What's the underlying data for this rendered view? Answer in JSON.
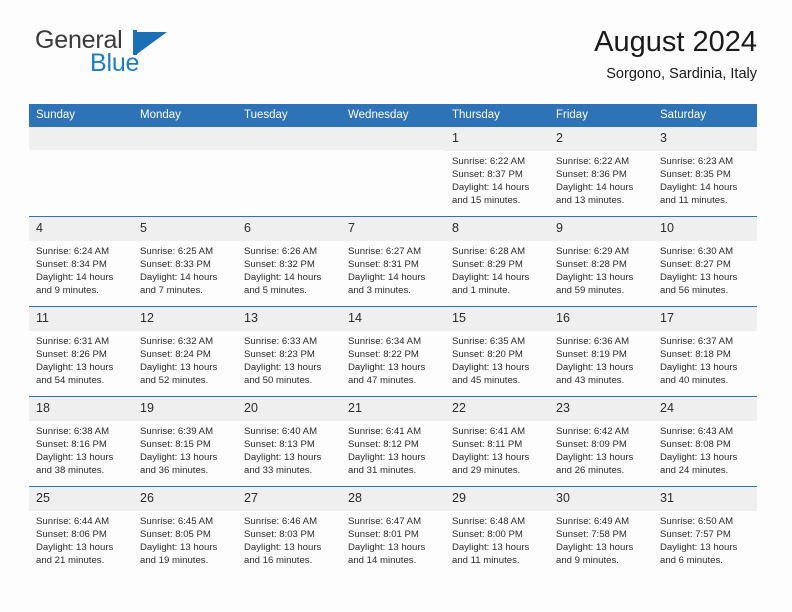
{
  "brand": {
    "name_top": "General",
    "name_bottom": "Blue",
    "mark": "triangle-flag-icon",
    "color_top": "#3b3b3b",
    "color_bottom": "#1f7dc4"
  },
  "header": {
    "title": "August 2024",
    "subtitle": "Sorgono, Sardinia, Italy"
  },
  "colors": {
    "header_bar": "#2e72b8",
    "daynum_band": "#efefef",
    "row_rule": "#2e72b8",
    "text": "#2b2b2b",
    "page_background": "#fdfdfd"
  },
  "weekday_headers": [
    "Sunday",
    "Monday",
    "Tuesday",
    "Wednesday",
    "Thursday",
    "Friday",
    "Saturday"
  ],
  "labels": {
    "sunrise_prefix": "Sunrise:",
    "sunset_prefix": "Sunset:",
    "daylight_prefix": "Daylight:"
  },
  "weeks": [
    [
      {
        "day": "",
        "empty": true
      },
      {
        "day": "",
        "empty": true
      },
      {
        "day": "",
        "empty": true
      },
      {
        "day": "",
        "empty": true
      },
      {
        "day": "1",
        "sunrise": "Sunrise: 6:22 AM",
        "sunset": "Sunset: 8:37 PM",
        "daylight": "Daylight: 14 hours and 15 minutes."
      },
      {
        "day": "2",
        "sunrise": "Sunrise: 6:22 AM",
        "sunset": "Sunset: 8:36 PM",
        "daylight": "Daylight: 14 hours and 13 minutes."
      },
      {
        "day": "3",
        "sunrise": "Sunrise: 6:23 AM",
        "sunset": "Sunset: 8:35 PM",
        "daylight": "Daylight: 14 hours and 11 minutes."
      }
    ],
    [
      {
        "day": "4",
        "sunrise": "Sunrise: 6:24 AM",
        "sunset": "Sunset: 8:34 PM",
        "daylight": "Daylight: 14 hours and 9 minutes."
      },
      {
        "day": "5",
        "sunrise": "Sunrise: 6:25 AM",
        "sunset": "Sunset: 8:33 PM",
        "daylight": "Daylight: 14 hours and 7 minutes."
      },
      {
        "day": "6",
        "sunrise": "Sunrise: 6:26 AM",
        "sunset": "Sunset: 8:32 PM",
        "daylight": "Daylight: 14 hours and 5 minutes."
      },
      {
        "day": "7",
        "sunrise": "Sunrise: 6:27 AM",
        "sunset": "Sunset: 8:31 PM",
        "daylight": "Daylight: 14 hours and 3 minutes."
      },
      {
        "day": "8",
        "sunrise": "Sunrise: 6:28 AM",
        "sunset": "Sunset: 8:29 PM",
        "daylight": "Daylight: 14 hours and 1 minute."
      },
      {
        "day": "9",
        "sunrise": "Sunrise: 6:29 AM",
        "sunset": "Sunset: 8:28 PM",
        "daylight": "Daylight: 13 hours and 59 minutes."
      },
      {
        "day": "10",
        "sunrise": "Sunrise: 6:30 AM",
        "sunset": "Sunset: 8:27 PM",
        "daylight": "Daylight: 13 hours and 56 minutes."
      }
    ],
    [
      {
        "day": "11",
        "sunrise": "Sunrise: 6:31 AM",
        "sunset": "Sunset: 8:26 PM",
        "daylight": "Daylight: 13 hours and 54 minutes."
      },
      {
        "day": "12",
        "sunrise": "Sunrise: 6:32 AM",
        "sunset": "Sunset: 8:24 PM",
        "daylight": "Daylight: 13 hours and 52 minutes."
      },
      {
        "day": "13",
        "sunrise": "Sunrise: 6:33 AM",
        "sunset": "Sunset: 8:23 PM",
        "daylight": "Daylight: 13 hours and 50 minutes."
      },
      {
        "day": "14",
        "sunrise": "Sunrise: 6:34 AM",
        "sunset": "Sunset: 8:22 PM",
        "daylight": "Daylight: 13 hours and 47 minutes."
      },
      {
        "day": "15",
        "sunrise": "Sunrise: 6:35 AM",
        "sunset": "Sunset: 8:20 PM",
        "daylight": "Daylight: 13 hours and 45 minutes."
      },
      {
        "day": "16",
        "sunrise": "Sunrise: 6:36 AM",
        "sunset": "Sunset: 8:19 PM",
        "daylight": "Daylight: 13 hours and 43 minutes."
      },
      {
        "day": "17",
        "sunrise": "Sunrise: 6:37 AM",
        "sunset": "Sunset: 8:18 PM",
        "daylight": "Daylight: 13 hours and 40 minutes."
      }
    ],
    [
      {
        "day": "18",
        "sunrise": "Sunrise: 6:38 AM",
        "sunset": "Sunset: 8:16 PM",
        "daylight": "Daylight: 13 hours and 38 minutes."
      },
      {
        "day": "19",
        "sunrise": "Sunrise: 6:39 AM",
        "sunset": "Sunset: 8:15 PM",
        "daylight": "Daylight: 13 hours and 36 minutes."
      },
      {
        "day": "20",
        "sunrise": "Sunrise: 6:40 AM",
        "sunset": "Sunset: 8:13 PM",
        "daylight": "Daylight: 13 hours and 33 minutes."
      },
      {
        "day": "21",
        "sunrise": "Sunrise: 6:41 AM",
        "sunset": "Sunset: 8:12 PM",
        "daylight": "Daylight: 13 hours and 31 minutes."
      },
      {
        "day": "22",
        "sunrise": "Sunrise: 6:41 AM",
        "sunset": "Sunset: 8:11 PM",
        "daylight": "Daylight: 13 hours and 29 minutes."
      },
      {
        "day": "23",
        "sunrise": "Sunrise: 6:42 AM",
        "sunset": "Sunset: 8:09 PM",
        "daylight": "Daylight: 13 hours and 26 minutes."
      },
      {
        "day": "24",
        "sunrise": "Sunrise: 6:43 AM",
        "sunset": "Sunset: 8:08 PM",
        "daylight": "Daylight: 13 hours and 24 minutes."
      }
    ],
    [
      {
        "day": "25",
        "sunrise": "Sunrise: 6:44 AM",
        "sunset": "Sunset: 8:06 PM",
        "daylight": "Daylight: 13 hours and 21 minutes."
      },
      {
        "day": "26",
        "sunrise": "Sunrise: 6:45 AM",
        "sunset": "Sunset: 8:05 PM",
        "daylight": "Daylight: 13 hours and 19 minutes."
      },
      {
        "day": "27",
        "sunrise": "Sunrise: 6:46 AM",
        "sunset": "Sunset: 8:03 PM",
        "daylight": "Daylight: 13 hours and 16 minutes."
      },
      {
        "day": "28",
        "sunrise": "Sunrise: 6:47 AM",
        "sunset": "Sunset: 8:01 PM",
        "daylight": "Daylight: 13 hours and 14 minutes."
      },
      {
        "day": "29",
        "sunrise": "Sunrise: 6:48 AM",
        "sunset": "Sunset: 8:00 PM",
        "daylight": "Daylight: 13 hours and 11 minutes."
      },
      {
        "day": "30",
        "sunrise": "Sunrise: 6:49 AM",
        "sunset": "Sunset: 7:58 PM",
        "daylight": "Daylight: 13 hours and 9 minutes."
      },
      {
        "day": "31",
        "sunrise": "Sunrise: 6:50 AM",
        "sunset": "Sunset: 7:57 PM",
        "daylight": "Daylight: 13 hours and 6 minutes."
      }
    ]
  ]
}
